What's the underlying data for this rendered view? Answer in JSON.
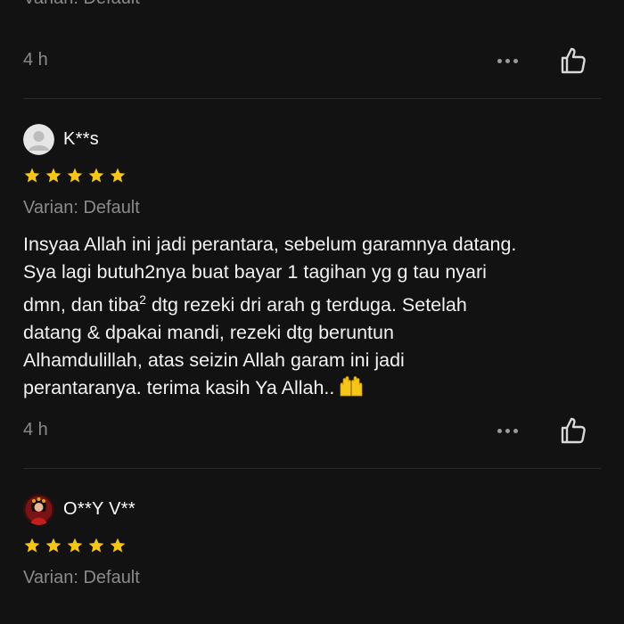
{
  "top_review": {
    "variant": "Varian: Default",
    "time": "4 h"
  },
  "reviews": [
    {
      "username": "K**s",
      "rating": 5,
      "variant": "Varian: Default",
      "text_line1": "Insyaa Allah ini jadi perantara, sebelum garamnya datang.",
      "text_line2": "Sya lagi butuh2nya buat bayar 1 tagihan yg g tau nyari",
      "text_line3a": "dmn, dan tiba",
      "text_sup": "2",
      "text_line3b": " dtg rezeki dri arah g terduga. Setelah",
      "text_line4": "datang & dpakai mandi, rezeki dtg beruntun",
      "text_line5": "Alhamdulillah, atas seizin Allah garam ini jadi",
      "text_line6": "perantaranya. terima kasih Ya Allah..",
      "emoji_icon": "raising-hands-emoji",
      "time": "4 h"
    },
    {
      "username": "O**Y V**",
      "rating": 5,
      "variant": "Varian: Default"
    }
  ],
  "icons": {
    "more": "more-horizontal-icon",
    "like": "thumbs-up-icon",
    "star": "star-icon",
    "avatar_default": "default-avatar-icon"
  },
  "colors": {
    "background": "#121212",
    "star": "#F5C518",
    "muted_text": "#8a8a8a"
  }
}
